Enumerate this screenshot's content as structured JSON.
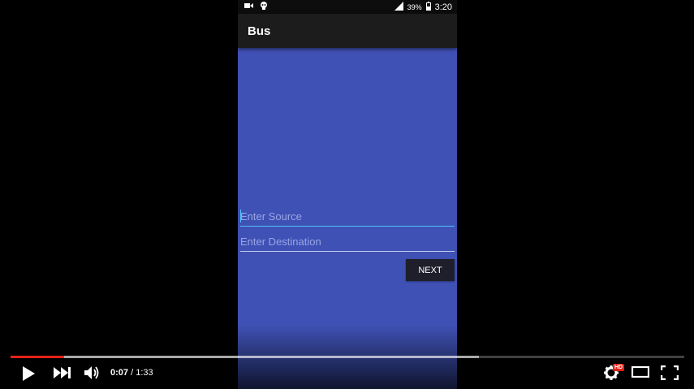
{
  "status_bar": {
    "battery_percent": "39%",
    "time": "3:20",
    "left_icons": [
      "video-camera-icon",
      "notification-icon"
    ],
    "right_icons": [
      "signal-icon",
      "battery-icon"
    ]
  },
  "app": {
    "title": "Bus",
    "source_placeholder": "Enter Source",
    "destination_placeholder": "Enter Destination",
    "next_label": "NEXT",
    "background_color": "#3f51b5",
    "accent_color": "#4fc3f7"
  },
  "player": {
    "current_time": "0:07",
    "separator": " / ",
    "duration": "1:33",
    "played_fraction": 0.08,
    "buffered_fraction": 0.695,
    "hd_badge": "HD",
    "progress_color": "#e62117",
    "controls": [
      "play-icon",
      "next-video-icon",
      "volume-icon",
      "settings-icon",
      "theater-mode-icon",
      "fullscreen-icon"
    ]
  }
}
